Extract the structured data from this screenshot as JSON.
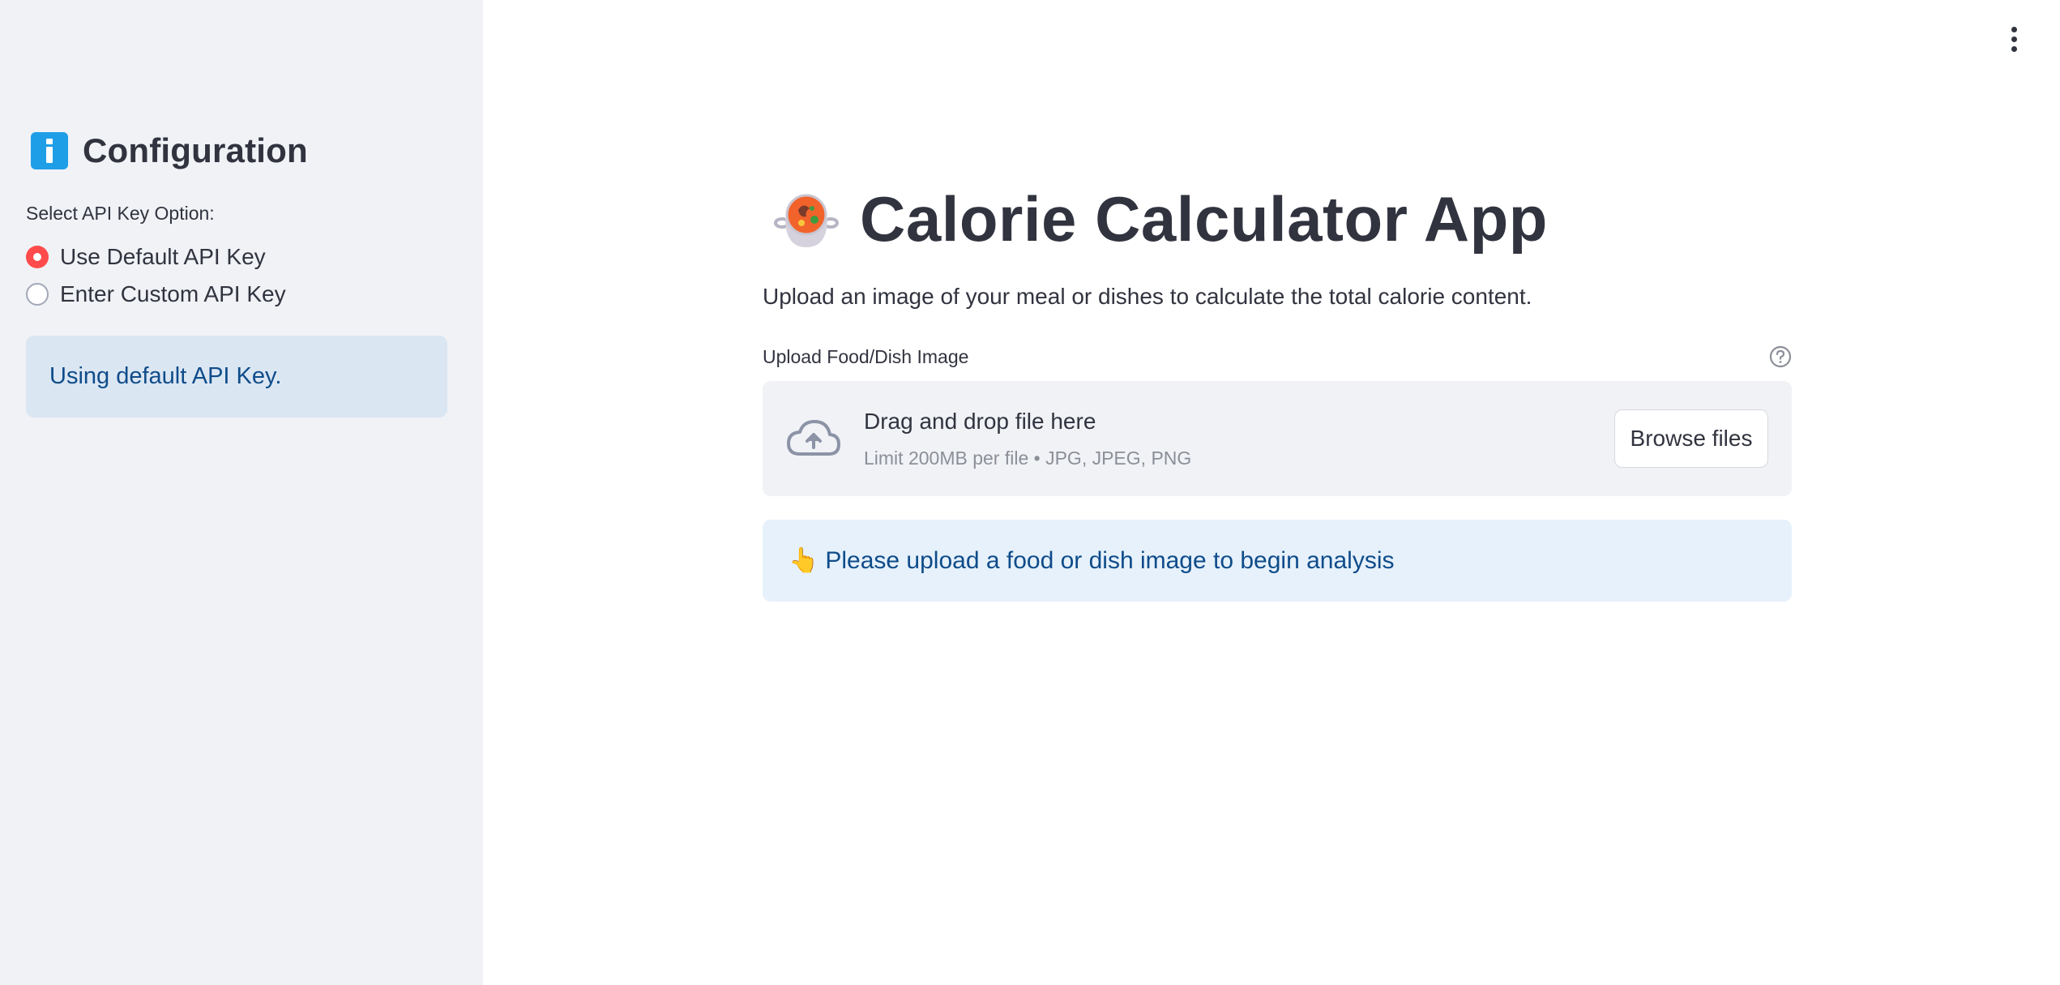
{
  "sidebar": {
    "heading": "Configuration",
    "heading_icon": "info-icon",
    "radio_label": "Select API Key Option:",
    "options": [
      {
        "label": "Use Default API Key",
        "selected": true
      },
      {
        "label": "Enter Custom API Key",
        "selected": false
      }
    ],
    "info_message": "Using default API Key."
  },
  "main": {
    "menu_icon": "kebab-menu-icon",
    "title_icon": "stew-pot-icon",
    "title": "Calorie Calculator App",
    "subtitle": "Upload an image of your meal or dishes to calculate the total calorie content.",
    "uploader": {
      "label": "Upload Food/Dish Image",
      "help_icon": "help-icon",
      "drop_text": "Drag and drop file here",
      "limit_text": "Limit 200MB per file • JPG, JPEG, PNG",
      "browse_label": "Browse files"
    },
    "info_icon": "pointing-hand-icon",
    "info_message": "Please upload a food or dish image to begin analysis"
  },
  "colors": {
    "sidebar_bg": "#f0f2f6",
    "accent_red": "#ff4b4b",
    "info_bg": "#e6f1fb",
    "info_text": "#0f4c8a",
    "text": "#31333f"
  }
}
